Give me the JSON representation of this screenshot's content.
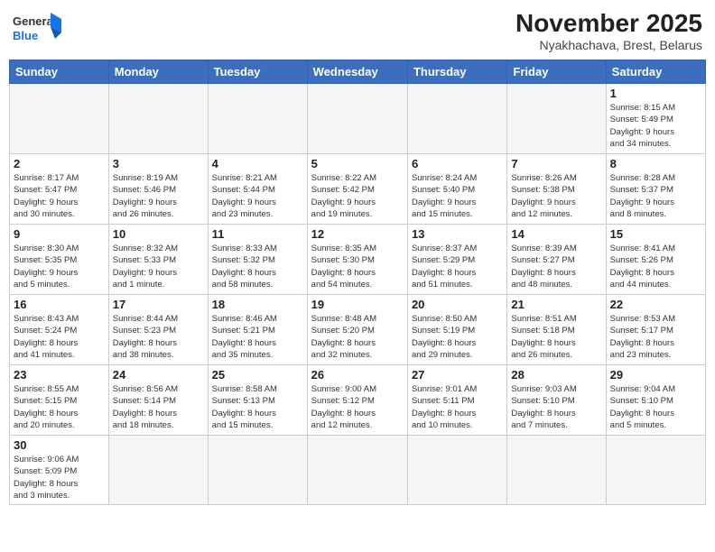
{
  "header": {
    "logo_general": "General",
    "logo_blue": "Blue",
    "month_title": "November 2025",
    "location": "Nyakhachava, Brest, Belarus"
  },
  "weekdays": [
    "Sunday",
    "Monday",
    "Tuesday",
    "Wednesday",
    "Thursday",
    "Friday",
    "Saturday"
  ],
  "weeks": [
    [
      {
        "day": "",
        "info": ""
      },
      {
        "day": "",
        "info": ""
      },
      {
        "day": "",
        "info": ""
      },
      {
        "day": "",
        "info": ""
      },
      {
        "day": "",
        "info": ""
      },
      {
        "day": "",
        "info": ""
      },
      {
        "day": "1",
        "info": "Sunrise: 8:15 AM\nSunset: 5:49 PM\nDaylight: 9 hours\nand 34 minutes."
      }
    ],
    [
      {
        "day": "2",
        "info": "Sunrise: 8:17 AM\nSunset: 5:47 PM\nDaylight: 9 hours\nand 30 minutes."
      },
      {
        "day": "3",
        "info": "Sunrise: 8:19 AM\nSunset: 5:46 PM\nDaylight: 9 hours\nand 26 minutes."
      },
      {
        "day": "4",
        "info": "Sunrise: 8:21 AM\nSunset: 5:44 PM\nDaylight: 9 hours\nand 23 minutes."
      },
      {
        "day": "5",
        "info": "Sunrise: 8:22 AM\nSunset: 5:42 PM\nDaylight: 9 hours\nand 19 minutes."
      },
      {
        "day": "6",
        "info": "Sunrise: 8:24 AM\nSunset: 5:40 PM\nDaylight: 9 hours\nand 15 minutes."
      },
      {
        "day": "7",
        "info": "Sunrise: 8:26 AM\nSunset: 5:38 PM\nDaylight: 9 hours\nand 12 minutes."
      },
      {
        "day": "8",
        "info": "Sunrise: 8:28 AM\nSunset: 5:37 PM\nDaylight: 9 hours\nand 8 minutes."
      }
    ],
    [
      {
        "day": "9",
        "info": "Sunrise: 8:30 AM\nSunset: 5:35 PM\nDaylight: 9 hours\nand 5 minutes."
      },
      {
        "day": "10",
        "info": "Sunrise: 8:32 AM\nSunset: 5:33 PM\nDaylight: 9 hours\nand 1 minute."
      },
      {
        "day": "11",
        "info": "Sunrise: 8:33 AM\nSunset: 5:32 PM\nDaylight: 8 hours\nand 58 minutes."
      },
      {
        "day": "12",
        "info": "Sunrise: 8:35 AM\nSunset: 5:30 PM\nDaylight: 8 hours\nand 54 minutes."
      },
      {
        "day": "13",
        "info": "Sunrise: 8:37 AM\nSunset: 5:29 PM\nDaylight: 8 hours\nand 51 minutes."
      },
      {
        "day": "14",
        "info": "Sunrise: 8:39 AM\nSunset: 5:27 PM\nDaylight: 8 hours\nand 48 minutes."
      },
      {
        "day": "15",
        "info": "Sunrise: 8:41 AM\nSunset: 5:26 PM\nDaylight: 8 hours\nand 44 minutes."
      }
    ],
    [
      {
        "day": "16",
        "info": "Sunrise: 8:43 AM\nSunset: 5:24 PM\nDaylight: 8 hours\nand 41 minutes."
      },
      {
        "day": "17",
        "info": "Sunrise: 8:44 AM\nSunset: 5:23 PM\nDaylight: 8 hours\nand 38 minutes."
      },
      {
        "day": "18",
        "info": "Sunrise: 8:46 AM\nSunset: 5:21 PM\nDaylight: 8 hours\nand 35 minutes."
      },
      {
        "day": "19",
        "info": "Sunrise: 8:48 AM\nSunset: 5:20 PM\nDaylight: 8 hours\nand 32 minutes."
      },
      {
        "day": "20",
        "info": "Sunrise: 8:50 AM\nSunset: 5:19 PM\nDaylight: 8 hours\nand 29 minutes."
      },
      {
        "day": "21",
        "info": "Sunrise: 8:51 AM\nSunset: 5:18 PM\nDaylight: 8 hours\nand 26 minutes."
      },
      {
        "day": "22",
        "info": "Sunrise: 8:53 AM\nSunset: 5:17 PM\nDaylight: 8 hours\nand 23 minutes."
      }
    ],
    [
      {
        "day": "23",
        "info": "Sunrise: 8:55 AM\nSunset: 5:15 PM\nDaylight: 8 hours\nand 20 minutes."
      },
      {
        "day": "24",
        "info": "Sunrise: 8:56 AM\nSunset: 5:14 PM\nDaylight: 8 hours\nand 18 minutes."
      },
      {
        "day": "25",
        "info": "Sunrise: 8:58 AM\nSunset: 5:13 PM\nDaylight: 8 hours\nand 15 minutes."
      },
      {
        "day": "26",
        "info": "Sunrise: 9:00 AM\nSunset: 5:12 PM\nDaylight: 8 hours\nand 12 minutes."
      },
      {
        "day": "27",
        "info": "Sunrise: 9:01 AM\nSunset: 5:11 PM\nDaylight: 8 hours\nand 10 minutes."
      },
      {
        "day": "28",
        "info": "Sunrise: 9:03 AM\nSunset: 5:10 PM\nDaylight: 8 hours\nand 7 minutes."
      },
      {
        "day": "29",
        "info": "Sunrise: 9:04 AM\nSunset: 5:10 PM\nDaylight: 8 hours\nand 5 minutes."
      }
    ],
    [
      {
        "day": "30",
        "info": "Sunrise: 9:06 AM\nSunset: 5:09 PM\nDaylight: 8 hours\nand 3 minutes."
      },
      {
        "day": "",
        "info": ""
      },
      {
        "day": "",
        "info": ""
      },
      {
        "day": "",
        "info": ""
      },
      {
        "day": "",
        "info": ""
      },
      {
        "day": "",
        "info": ""
      },
      {
        "day": "",
        "info": ""
      }
    ]
  ]
}
